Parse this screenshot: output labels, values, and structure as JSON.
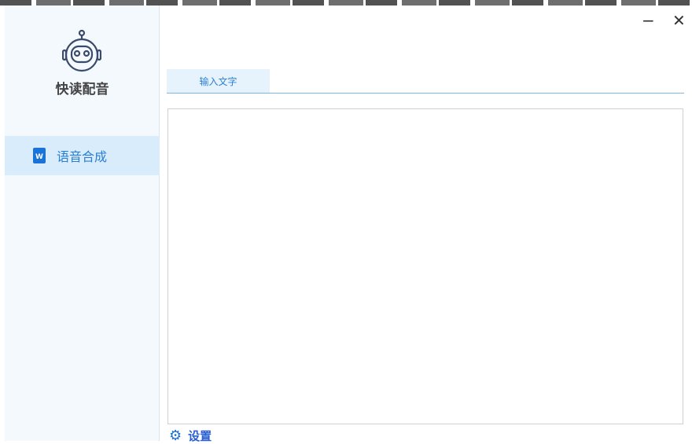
{
  "app": {
    "name": "快读配音"
  },
  "sidebar": {
    "items": [
      {
        "label": "语音合成",
        "icon": "word-doc-icon",
        "active": true
      }
    ]
  },
  "window": {
    "minimize": "−",
    "close": "✕"
  },
  "tabs": [
    {
      "label": "输入文字",
      "active": true
    }
  ],
  "editor": {
    "value": "",
    "placeholder": ""
  },
  "footer": {
    "settings_label": "设置",
    "settings_icon": "⚙"
  },
  "colors": {
    "accent": "#2a7fd4",
    "sidebar_bg": "#f4f9fe",
    "active_bg": "#d9ecfc"
  }
}
